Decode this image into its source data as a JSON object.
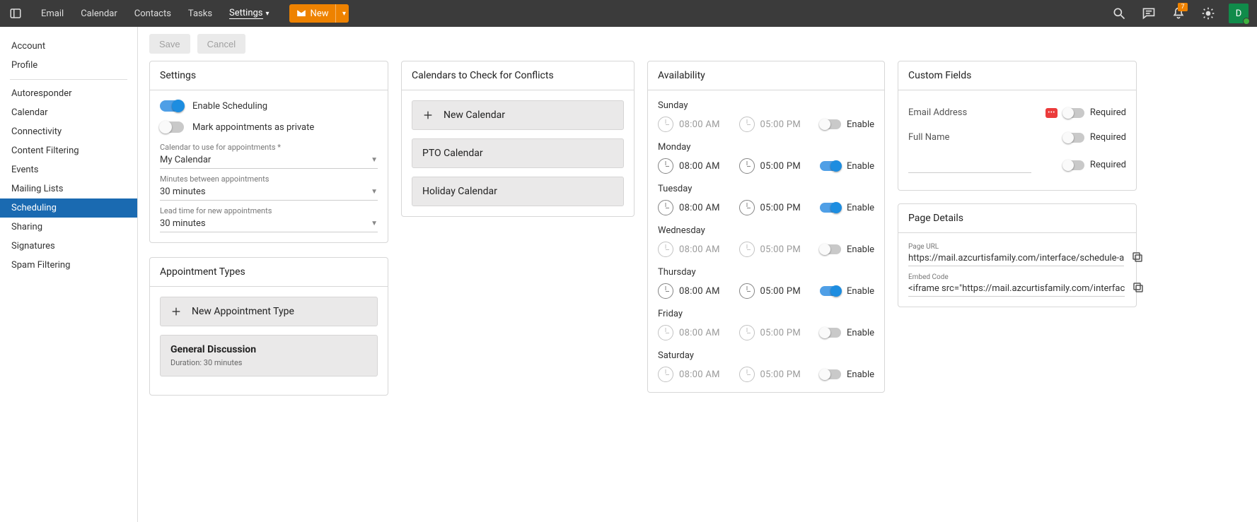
{
  "topbar": {
    "nav": [
      "Email",
      "Calendar",
      "Contacts",
      "Tasks",
      "Settings"
    ],
    "active_index": 4,
    "new_label": "New",
    "notification_count": "7",
    "avatar_initial": "D"
  },
  "sidebar": {
    "group_a": [
      "Account",
      "Profile"
    ],
    "group_b": [
      "Autoresponder",
      "Calendar",
      "Connectivity",
      "Content Filtering",
      "Events",
      "Mailing Lists",
      "Scheduling",
      "Sharing",
      "Signatures",
      "Spam Filtering"
    ],
    "selected": "Scheduling"
  },
  "toolbar": {
    "save": "Save",
    "cancel": "Cancel"
  },
  "settings_card": {
    "title": "Settings",
    "enable_scheduling": {
      "label": "Enable Scheduling",
      "on": true
    },
    "mark_private": {
      "label": "Mark appointments as private",
      "on": false
    },
    "calendar_field": {
      "label": "Calendar to use for appointments *",
      "value": "My Calendar"
    },
    "minutes_between": {
      "label": "Minutes between appointments",
      "value": "30 minutes"
    },
    "lead_time": {
      "label": "Lead time for new appointments",
      "value": "30 minutes"
    }
  },
  "appt_types": {
    "title": "Appointment Types",
    "add_label": "New Appointment Type",
    "items": [
      {
        "name": "General Discussion",
        "sub": "Duration: 30 minutes"
      }
    ]
  },
  "conflict_cals": {
    "title": "Calendars to Check for Conflicts",
    "add_label": "New Calendar",
    "items": [
      "PTO Calendar",
      "Holiday Calendar"
    ]
  },
  "availability": {
    "title": "Availability",
    "enable_label": "Enable",
    "days": [
      {
        "name": "Sunday",
        "start": "08:00 AM",
        "end": "05:00 PM",
        "enabled": false
      },
      {
        "name": "Monday",
        "start": "08:00 AM",
        "end": "05:00 PM",
        "enabled": true
      },
      {
        "name": "Tuesday",
        "start": "08:00 AM",
        "end": "05:00 PM",
        "enabled": true
      },
      {
        "name": "Wednesday",
        "start": "08:00 AM",
        "end": "05:00 PM",
        "enabled": false
      },
      {
        "name": "Thursday",
        "start": "08:00 AM",
        "end": "05:00 PM",
        "enabled": true
      },
      {
        "name": "Friday",
        "start": "08:00 AM",
        "end": "05:00 PM",
        "enabled": false
      },
      {
        "name": "Saturday",
        "start": "08:00 AM",
        "end": "05:00 PM",
        "enabled": false
      }
    ]
  },
  "custom_fields": {
    "title": "Custom Fields",
    "required_label": "Required",
    "rows": [
      {
        "label": "Email Address",
        "required_chip": true,
        "on": false
      },
      {
        "label": "Full Name",
        "required_chip": false,
        "on": false
      },
      {
        "label": "",
        "required_chip": false,
        "on": false
      }
    ]
  },
  "page_details": {
    "title": "Page Details",
    "url_label": "Page URL",
    "url_value": "https://mail.azcurtisfamily.com/interface/schedule-a",
    "embed_label": "Embed Code",
    "embed_value": "<iframe src=\"https://mail.azcurtisfamily.com/interfac"
  }
}
